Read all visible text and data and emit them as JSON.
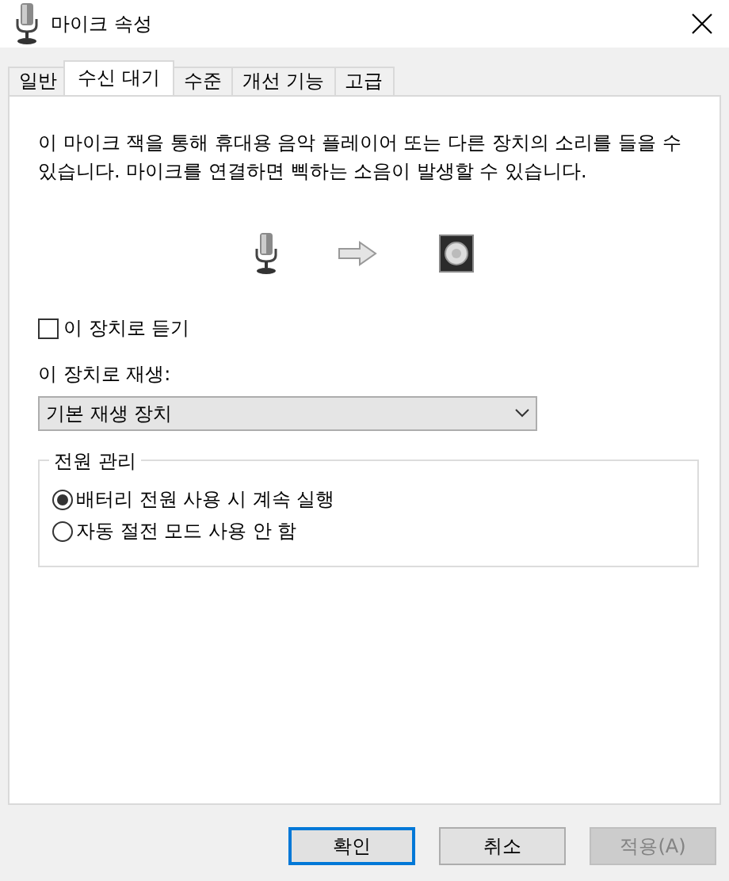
{
  "window": {
    "title": "마이크 속성"
  },
  "tabs": [
    {
      "label": "일반",
      "selected": false
    },
    {
      "label": "수신 대기",
      "selected": true
    },
    {
      "label": "수준",
      "selected": false
    },
    {
      "label": "개선 기능",
      "selected": false
    },
    {
      "label": "고급",
      "selected": false
    }
  ],
  "description": "이 마이크 잭을 통해 휴대용 음악 플레이어 또는 다른 장치의 소리를 들을 수 있습니다. 마이크를 연결하면 삑하는 소음이 발생할 수 있습니다.",
  "listen_checkbox": {
    "label": "이 장치로 듣기",
    "checked": false
  },
  "playback": {
    "label": "이 장치로 재생:",
    "value": "기본 재생 장치"
  },
  "power": {
    "legend": "전원 관리",
    "options": [
      {
        "label": "배터리 전원 사용 시 계속 실행",
        "selected": true
      },
      {
        "label": "자동 절전 모드 사용 안 함",
        "selected": false
      }
    ]
  },
  "buttons": [
    {
      "label": "확인",
      "default": true,
      "disabled": false
    },
    {
      "label": "취소",
      "default": false,
      "disabled": false
    },
    {
      "label": "적용(A)",
      "default": false,
      "disabled": true
    }
  ]
}
